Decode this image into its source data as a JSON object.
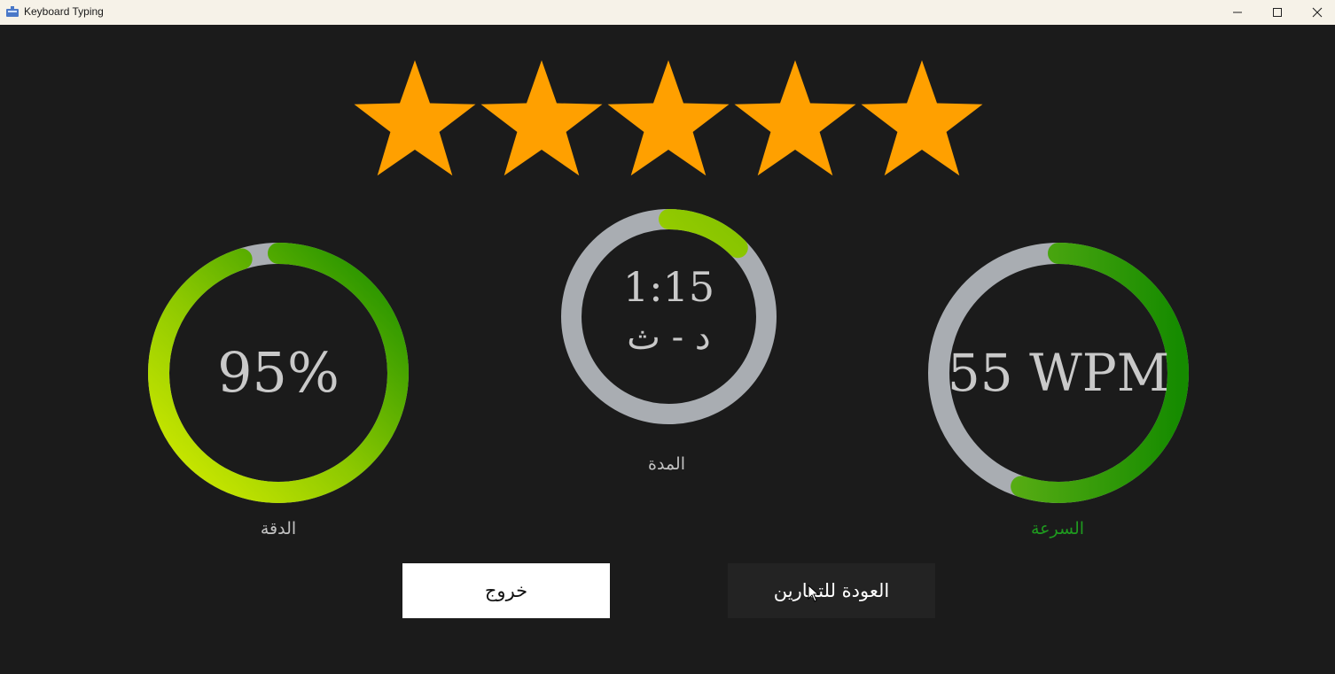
{
  "window": {
    "title": "Keyboard Typing",
    "icons": [
      "app-icon",
      "minimize-icon",
      "maximize-icon",
      "close-icon"
    ]
  },
  "rating": {
    "stars": 5,
    "max_stars": 5,
    "color": "#ffa000"
  },
  "accuracy": {
    "value_text": "95%",
    "label": "الدقة",
    "progress": 0.95,
    "label_color": "#c2c2c2"
  },
  "duration": {
    "time_text": "1:15",
    "unit_text": "د - ث",
    "label": "المدة",
    "progress": 0.125
  },
  "speed": {
    "value_text": "55 WPM",
    "label": "السرعة",
    "progress": 0.55,
    "label_color": "#1f9a1f"
  },
  "buttons": {
    "exit_label": "خروج",
    "back_label": "العودة للتمارين"
  },
  "colors": {
    "background": "#1b1b1b",
    "track": "#a9adb2",
    "gradient_yellow": "#d8ee00",
    "gradient_green": "#168b00"
  }
}
